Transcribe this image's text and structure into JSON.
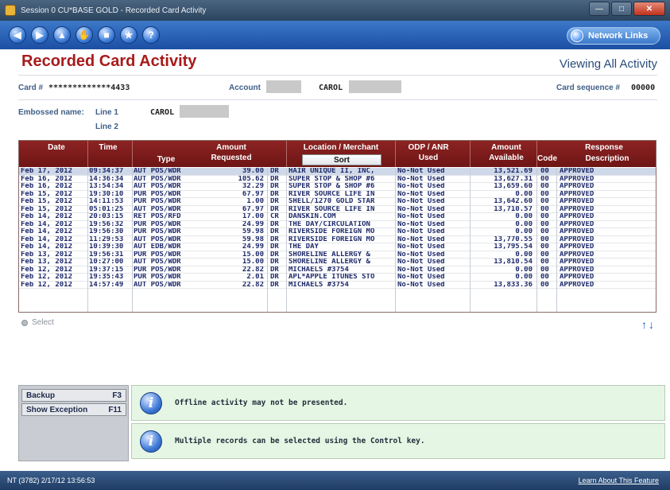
{
  "window": {
    "title": "Session 0 CU*BASE GOLD - Recorded Card Activity"
  },
  "toolbar": {
    "nav_buttons": [
      "back-icon",
      "forward-icon",
      "up-icon",
      "hand-icon",
      "home-icon",
      "star-icon",
      "help-icon"
    ],
    "nav_glyphs": [
      "◀",
      "▶",
      "▲",
      "✋",
      "■",
      "★",
      "?"
    ],
    "network_links_label": "Network Links"
  },
  "header": {
    "title": "Recorded Card Activity",
    "viewing": "Viewing All Activity"
  },
  "card_info": {
    "card_label": "Card #",
    "card_value": "*************4433",
    "account_label": "Account",
    "account_name": "CAROL",
    "sequence_label": "Card sequence #",
    "sequence_value": "00000"
  },
  "embossed": {
    "label": "Embossed name:",
    "line1_label": "Line 1",
    "line1_value": "CAROL",
    "line2_label": "Line 2"
  },
  "table": {
    "headers": {
      "date": "Date",
      "time": "Time",
      "type": "Type",
      "amount_line1": "Amount",
      "amount_line2": "Requested",
      "location": "Location / Merchant",
      "sort": "Sort",
      "odp_line1": "ODP / ANR",
      "odp_line2": "Used",
      "avail_line1": "Amount",
      "avail_line2": "Available",
      "response": "Response",
      "code": "Code",
      "description": "Description"
    },
    "rows": [
      {
        "date": "Feb 17, 2012",
        "time": "09:34:37",
        "type": "AUT POS/WDR",
        "amount": "39.00",
        "drcr": "DR",
        "merchant": "HAIR UNIQUE II, INC,",
        "odp": "No-Not Used",
        "available": "13,521.69",
        "code": "00",
        "desc": "APPROVED"
      },
      {
        "date": "Feb 16, 2012",
        "time": "14:36:34",
        "type": "AUT POS/WDR",
        "amount": "105.62",
        "drcr": "DR",
        "merchant": "SUPER STOP & SHOP #6",
        "odp": "No-Not Used",
        "available": "13,627.31",
        "code": "00",
        "desc": "APPROVED"
      },
      {
        "date": "Feb 16, 2012",
        "time": "13:54:34",
        "type": "AUT POS/WDR",
        "amount": "32.29",
        "drcr": "DR",
        "merchant": "SUPER STOP & SHOP #6",
        "odp": "No-Not Used",
        "available": "13,659.60",
        "code": "00",
        "desc": "APPROVED"
      },
      {
        "date": "Feb 15, 2012",
        "time": "19:30:10",
        "type": "PUR POS/WDR",
        "amount": "67.97",
        "drcr": "DR",
        "merchant": "RIVER SOURCE LIFE IN",
        "odp": "No-Not Used",
        "available": "0.00",
        "code": "00",
        "desc": "APPROVED"
      },
      {
        "date": "Feb 15, 2012",
        "time": "14:11:53",
        "type": "PUR POS/WDR",
        "amount": "1.00",
        "drcr": "DR",
        "merchant": "SHELL/1270 GOLD STAR",
        "odp": "No-Not Used",
        "available": "13,642.60",
        "code": "00",
        "desc": "APPROVED"
      },
      {
        "date": "Feb 15, 2012",
        "time": "05:01:25",
        "type": "AUT POS/WDR",
        "amount": "67.97",
        "drcr": "DR",
        "merchant": "RIVER SOURCE LIFE IN",
        "odp": "No-Not Used",
        "available": "13,710.57",
        "code": "00",
        "desc": "APPROVED"
      },
      {
        "date": "Feb 14, 2012",
        "time": "20:03:15",
        "type": "RET POS/RFD",
        "amount": "17.00",
        "drcr": "CR",
        "merchant": "DANSKIN.COM",
        "odp": "No-Not Used",
        "available": "0.00",
        "code": "00",
        "desc": "APPROVED"
      },
      {
        "date": "Feb 14, 2012",
        "time": "19:56:32",
        "type": "PUR POS/WDR",
        "amount": "24.99",
        "drcr": "DR",
        "merchant": "THE DAY/CIRCULATION",
        "odp": "No-Not Used",
        "available": "0.00",
        "code": "00",
        "desc": "APPROVED"
      },
      {
        "date": "Feb 14, 2012",
        "time": "19:56:30",
        "type": "PUR POS/WDR",
        "amount": "59.98",
        "drcr": "DR",
        "merchant": "RIVERSIDE FOREIGN MO",
        "odp": "No-Not Used",
        "available": "0.00",
        "code": "00",
        "desc": "APPROVED"
      },
      {
        "date": "Feb 14, 2012",
        "time": "11:29:53",
        "type": "AUT POS/WDR",
        "amount": "59.98",
        "drcr": "DR",
        "merchant": "RIVERSIDE FOREIGN MO",
        "odp": "No-Not Used",
        "available": "13,770.55",
        "code": "00",
        "desc": "APPROVED"
      },
      {
        "date": "Feb 14, 2012",
        "time": "10:39:30",
        "type": "AUT EDB/WDR",
        "amount": "24.99",
        "drcr": "DR",
        "merchant": "THE DAY",
        "odp": "No-Not Used",
        "available": "13,795.54",
        "code": "00",
        "desc": "APPROVED"
      },
      {
        "date": "Feb 13, 2012",
        "time": "19:56:31",
        "type": "PUR POS/WDR",
        "amount": "15.00",
        "drcr": "DR",
        "merchant": "SHORELINE ALLERGY &",
        "odp": "No-Not Used",
        "available": "0.00",
        "code": "00",
        "desc": "APPROVED"
      },
      {
        "date": "Feb 13, 2012",
        "time": "10:27:00",
        "type": "AUT POS/WDR",
        "amount": "15.00",
        "drcr": "DR",
        "merchant": "SHORELINE ALLERGY &",
        "odp": "No-Not Used",
        "available": "13,810.54",
        "code": "00",
        "desc": "APPROVED"
      },
      {
        "date": "Feb 12, 2012",
        "time": "19:37:15",
        "type": "PUR POS/WDR",
        "amount": "22.82",
        "drcr": "DR",
        "merchant": "MICHAELS #3754",
        "odp": "No-Not Used",
        "available": "0.00",
        "code": "00",
        "desc": "APPROVED"
      },
      {
        "date": "Feb 12, 2012",
        "time": "19:35:43",
        "type": "PUR POS/WDR",
        "amount": "2.01",
        "drcr": "DR",
        "merchant": "APL*APPLE ITUNES STO",
        "odp": "No-Not Used",
        "available": "0.00",
        "code": "00",
        "desc": "APPROVED"
      },
      {
        "date": "Feb 12, 2012",
        "time": "14:57:49",
        "type": "AUT POS/WDR",
        "amount": "22.82",
        "drcr": "DR",
        "merchant": "MICHAELS #3754",
        "odp": "No-Not Used",
        "available": "13,833.36",
        "code": "00",
        "desc": "APPROVED"
      }
    ]
  },
  "select_label": "Select",
  "scroll_arrows": "↑↓",
  "actions": [
    {
      "label": "Backup",
      "key": "F3"
    },
    {
      "label": "Show Exception",
      "key": "F11"
    }
  ],
  "messages": [
    "Offline activity may not be presented.",
    "Multiple records can be selected using the Control key."
  ],
  "info_glyph": "i",
  "status": {
    "left": "NT (3782) 2/17/12 13:56:53",
    "right": "Learn About This Feature"
  }
}
